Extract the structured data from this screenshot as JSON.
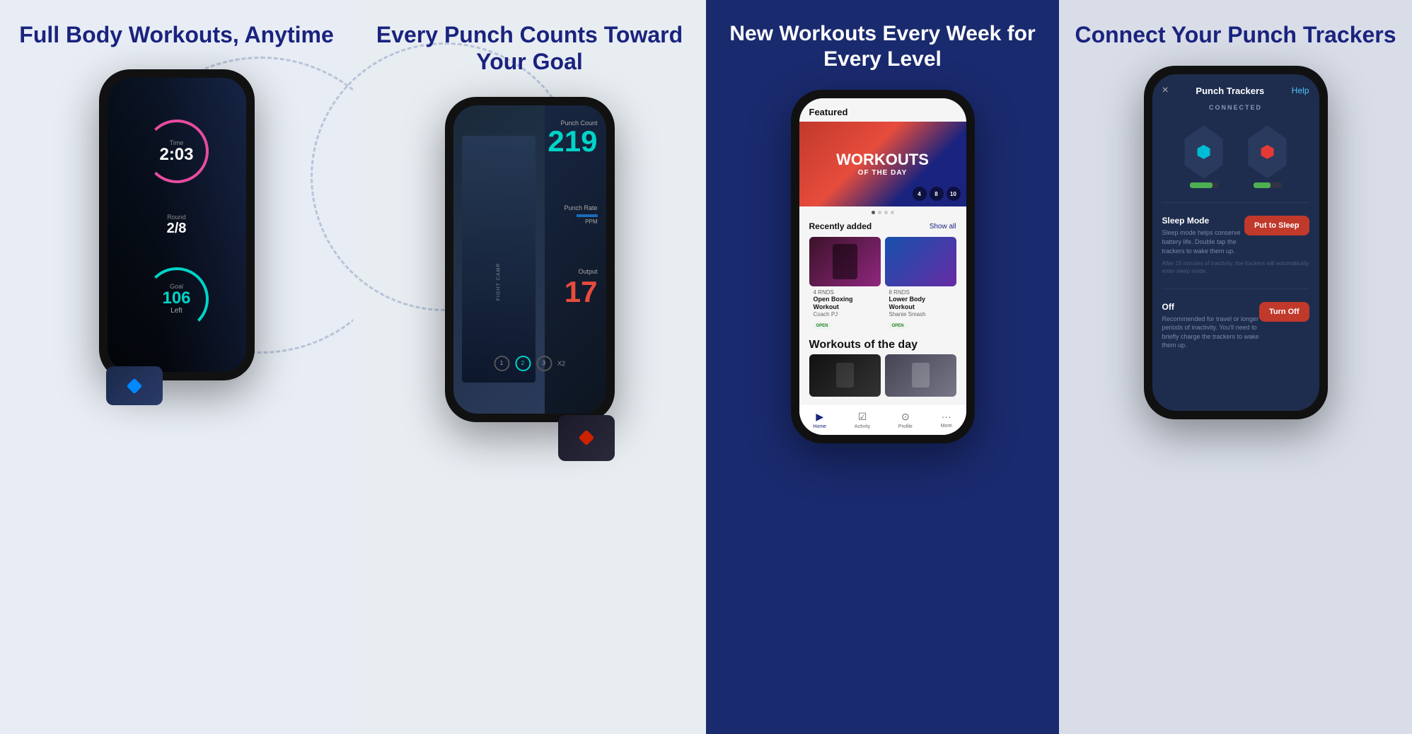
{
  "panels": [
    {
      "id": "panel1",
      "title": "Full Body Workouts, Anytime",
      "bg": "#e8edf5",
      "phone": {
        "timer": "2:03",
        "timer_label": "Time",
        "round": "2/8",
        "round_label": "Round",
        "goal": "106",
        "goal_label": "Goal",
        "goal_sub": "Left"
      }
    },
    {
      "id": "panel2",
      "title": "Every Punch Counts Toward Your Goal",
      "bg": "#e8edf2",
      "phone": {
        "punch_count_label": "Punch Count",
        "punch_count": "219",
        "punch_rate_label": "Punch Rate",
        "ppm": "PPM",
        "output_label": "Output",
        "output": "17",
        "rounds": [
          "1",
          "2",
          "3"
        ],
        "active_round": 1,
        "x2_label": "X2"
      }
    },
    {
      "id": "panel3",
      "title": "New Workouts Every Week for Every Level",
      "bg": "#1a2a6e",
      "phone": {
        "featured_label": "Featured",
        "featured_title": "WORKOUTS",
        "featured_sub": "OF THE DAY",
        "round_options": [
          "4",
          "8",
          "10"
        ],
        "recently_added_label": "Recently added",
        "show_all": "Show all",
        "workouts": [
          {
            "rounds": "4",
            "title": "Open Boxing Workout",
            "coach": "Coach PJ",
            "badge": "OPEN"
          },
          {
            "rounds": "8",
            "title": "Lower Body Workout",
            "coach": "Shanie Smash",
            "badge": "OPEN"
          }
        ],
        "wotd_label": "Workouts of the day",
        "nav": [
          "Home",
          "Activity",
          "Profile",
          "More"
        ]
      }
    },
    {
      "id": "panel4",
      "title": "Connect Your Punch Trackers",
      "bg": "#d8dde8",
      "phone": {
        "close_icon": "×",
        "header_title": "Punch Trackers",
        "help_label": "Help",
        "connected_label": "CONNECTED",
        "tracker_blue_battery": 80,
        "tracker_red_battery": 60,
        "sleep_mode_title": "Sleep Mode",
        "sleep_mode_desc": "Sleep mode helps conserve battery life. Double tap the trackers to wake them up.",
        "sleep_mode_extra": "After 15 minutes of inactivity, the trackers will automatically enter sleep mode.",
        "sleep_btn": "Put to Sleep",
        "off_title": "Off",
        "off_desc": "Recommended for travel or longer periods of inactivity. You'll need to briefly charge the trackers to wake them up.",
        "off_btn": "Turn Off"
      }
    }
  ]
}
